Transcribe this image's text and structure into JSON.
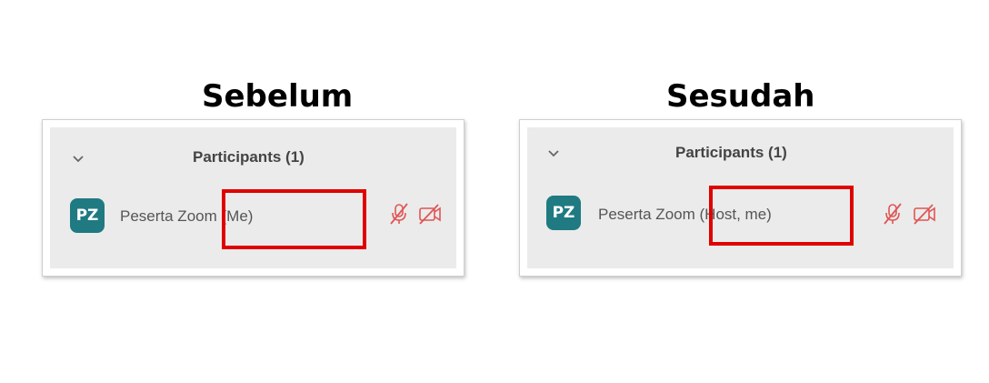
{
  "before": {
    "heading": "Sebelum",
    "panel_title": "Participants (1)",
    "participant": {
      "initials": "PZ",
      "name": "Peserta Zoom",
      "role": "(Me)"
    }
  },
  "after": {
    "heading": "Sesudah",
    "panel_title": "Participants (1)",
    "participant": {
      "initials": "PZ",
      "name": "Peserta Zoom",
      "role": "(Host, me)"
    }
  },
  "icons": [
    "chevron-down-icon",
    "mic-muted-icon",
    "video-off-icon"
  ],
  "colors": {
    "avatar": "#1f7a82",
    "highlight": "#e00000",
    "muted_icon": "#e05555",
    "panel_bg": "#ebebeb"
  }
}
